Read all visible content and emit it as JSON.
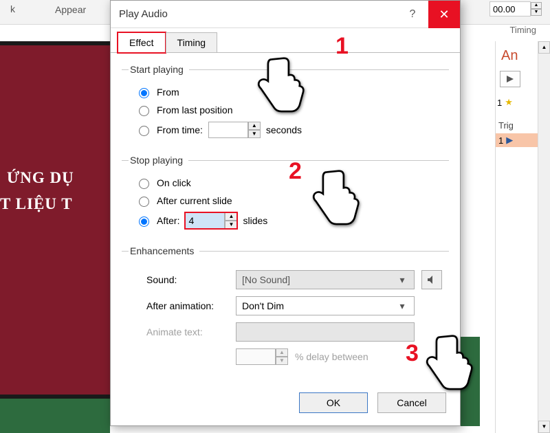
{
  "ribbon": {
    "k": "k",
    "appear": "Appear",
    "spinner": "00.00",
    "timing": "Timing"
  },
  "slide": {
    "line1": "ỨNG DỤ",
    "line2": "T LIỆU T"
  },
  "anim_pane": {
    "title": "An",
    "item1_num": "1",
    "trig": "Trig",
    "sel_num": "1"
  },
  "dialog": {
    "title": "Play Audio",
    "tabs": {
      "effect": "Effect",
      "timing": "Timing"
    },
    "start_playing": {
      "legend": "Start playing",
      "from_beginning": "From",
      "from_last": "From last position",
      "from_time": "From time:",
      "from_time_val": "",
      "seconds": "seconds"
    },
    "stop_playing": {
      "legend": "Stop playing",
      "on_click": "On click",
      "after_current": "After current slide",
      "after": "After:",
      "after_val": "4",
      "slides": "slides"
    },
    "enhancements": {
      "legend": "Enhancements",
      "sound": "Sound:",
      "sound_val": "[No Sound]",
      "after_anim": "After animation:",
      "after_anim_val": "Don't Dim",
      "animate_text": "Animate text:",
      "delay": "% delay between"
    },
    "ok": "OK",
    "cancel": "Cancel"
  },
  "annotations": {
    "n1": "1",
    "n2": "2",
    "n3": "3"
  }
}
